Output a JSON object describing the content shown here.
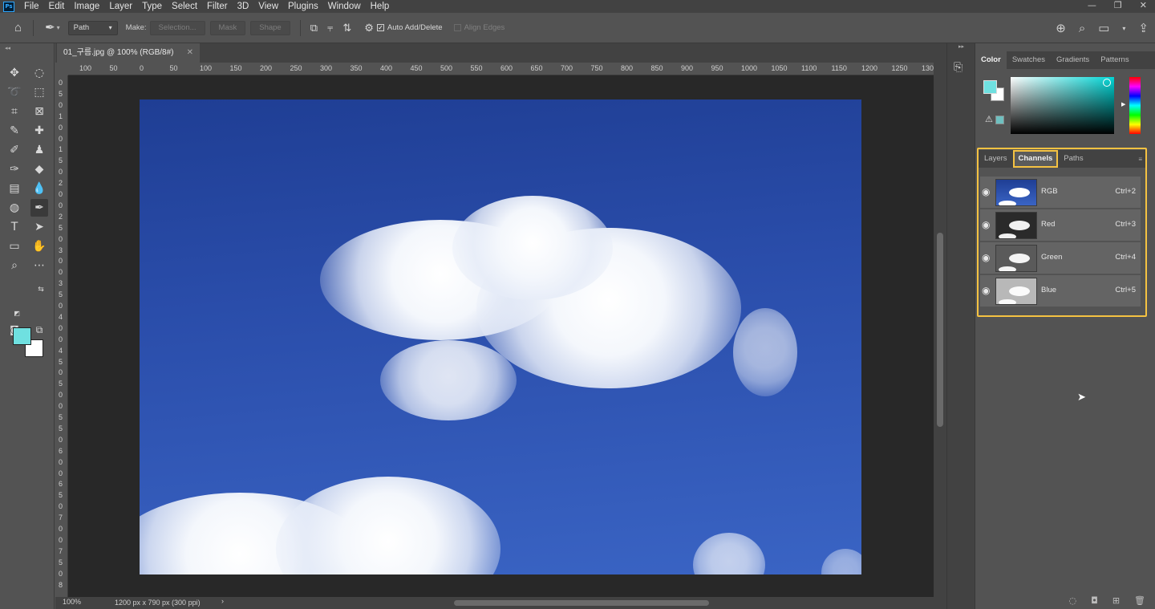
{
  "menubar": {
    "logo": "Ps",
    "items": [
      "File",
      "Edit",
      "Image",
      "Layer",
      "Type",
      "Select",
      "Filter",
      "3D",
      "View",
      "Plugins",
      "Window",
      "Help"
    ],
    "window_controls": [
      "—",
      "❐",
      "✕"
    ]
  },
  "options": {
    "mode_value": "Path",
    "make_label": "Make:",
    "selection_button": "Selection...",
    "mask_button": "Mask",
    "shape_button": "Shape",
    "auto_add_delete_label": "Auto Add/Delete",
    "align_edges_label": "Align Edges"
  },
  "document": {
    "tab_title": "01_구름.jpg @ 100% (RGB/8#)",
    "close": "✕",
    "zoom": "100%",
    "info": "1200 px x 790 px (300 ppi)"
  },
  "ruler": {
    "h_ticks": [
      "100",
      "50",
      "0",
      "50",
      "100",
      "150",
      "200",
      "250",
      "300",
      "350",
      "400",
      "450",
      "500",
      "550",
      "600",
      "650",
      "700",
      "750",
      "800",
      "850",
      "900",
      "950",
      "1000",
      "1050",
      "1100",
      "1150",
      "1200",
      "1250",
      "130"
    ],
    "v_ticks": [
      "0",
      "5",
      "0",
      "1",
      "0",
      "0",
      "1",
      "5",
      "0",
      "2",
      "0",
      "0",
      "2",
      "5",
      "0",
      "3",
      "0",
      "0",
      "3",
      "5",
      "0",
      "4",
      "0",
      "0",
      "4",
      "5",
      "0",
      "5",
      "0",
      "0",
      "5",
      "5",
      "0",
      "6",
      "0",
      "0",
      "6",
      "5",
      "0",
      "7",
      "0",
      "0",
      "7",
      "5",
      "0",
      "8"
    ]
  },
  "color_panel": {
    "tabs": [
      "Color",
      "Swatches",
      "Gradients",
      "Patterns"
    ],
    "active_tab": "Color",
    "foreground": "#6fe0e0",
    "background": "#ffffff"
  },
  "channels_panel": {
    "tabs": [
      "Layers",
      "Channels",
      "Paths"
    ],
    "active_tab": "Channels",
    "highlight_color": "#f5c242",
    "rows": [
      {
        "name": "RGB",
        "shortcut": "Ctrl+2"
      },
      {
        "name": "Red",
        "shortcut": "Ctrl+3"
      },
      {
        "name": "Green",
        "shortcut": "Ctrl+4"
      },
      {
        "name": "Blue",
        "shortcut": "Ctrl+5"
      }
    ]
  }
}
